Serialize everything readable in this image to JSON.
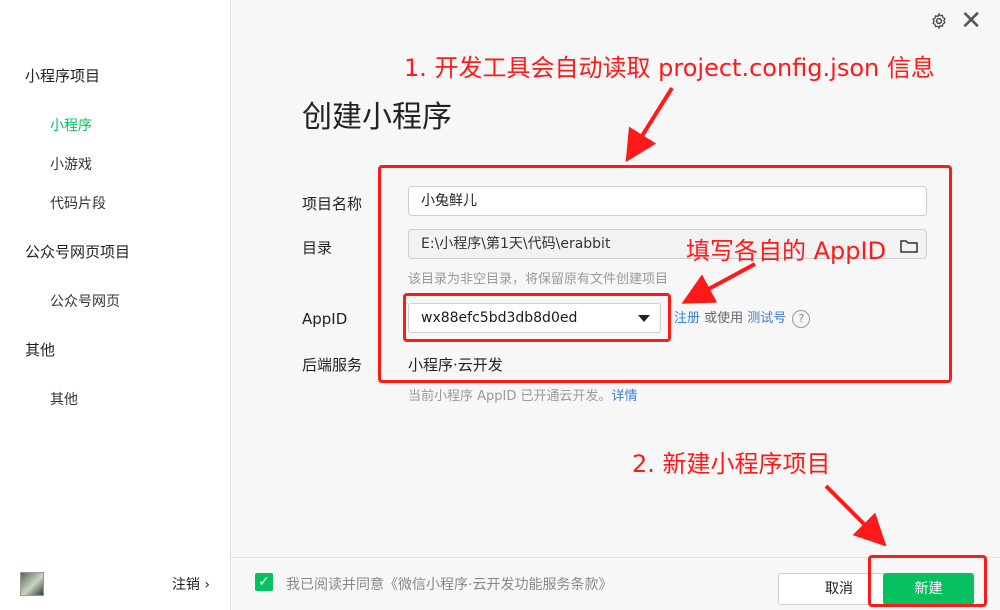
{
  "sidebar": {
    "group_mini": "小程序项目",
    "item_mini": "小程序",
    "item_game": "小游戏",
    "item_snippet": "代码片段",
    "group_oa": "公众号网页项目",
    "item_oa": "公众号网页",
    "group_other": "其他",
    "item_other": "其他",
    "logout": "注销 ›"
  },
  "form": {
    "title": "创建小程序",
    "name_label": "项目名称",
    "name_value": "小兔鲜儿",
    "dir_label": "目录",
    "dir_value": "E:\\小程序\\第1天\\代码\\erabbit",
    "dir_hint": "该目录为非空目录，将保留原有文件创建项目",
    "appid_label": "AppID",
    "appid_value": "wx88efc5bd3db8d0ed",
    "register_link": "注册",
    "or_use": " 或使用 ",
    "test_link": "测试号",
    "help": "?",
    "backend_label": "后端服务",
    "backend_value": "小程序·云开发",
    "cloud_hint": "当前小程序 AppID 已开通云开发。",
    "detail_link": "详情"
  },
  "footer": {
    "check": "✓",
    "agree_text": "我已阅读并同意《微信小程序·云开发功能服务条款》",
    "cancel": "取消",
    "create": "新建"
  },
  "annotations": {
    "step1": "1. 开发工具会自动读取 project.config.json 信息",
    "fill_appid": "填写各自的 AppID",
    "step2": "2. 新建小程序项目"
  },
  "colors": {
    "accent": "#07c160",
    "annotation": "#ff1a1a",
    "link": "#3b7fd6"
  }
}
